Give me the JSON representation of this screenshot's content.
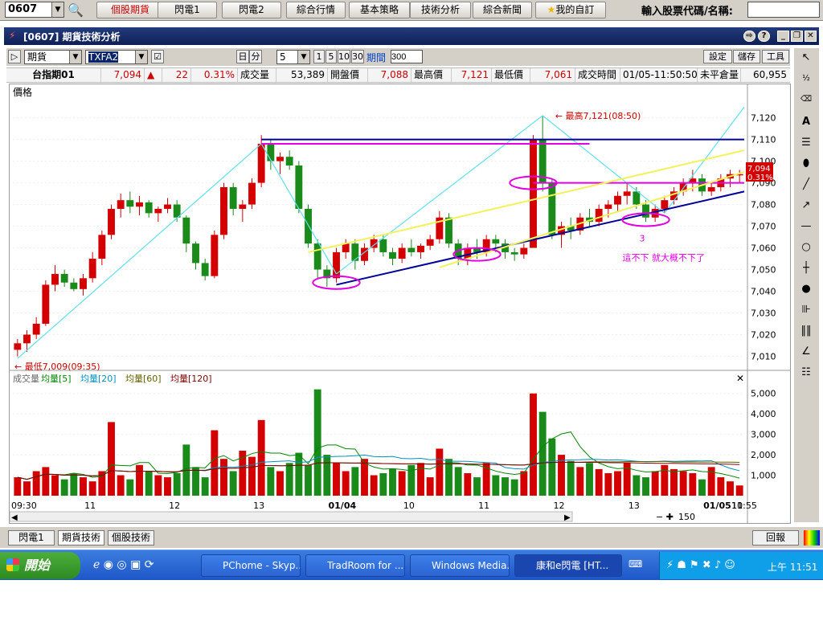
{
  "topbar": {
    "code": "0607",
    "tabs": [
      "個股期貨",
      "閃電1",
      "閃電2",
      "綜合行情",
      "基本策略",
      "技術分析",
      "綜合新聞"
    ],
    "favorite": "我的自訂",
    "input_label": "輸入股票代碼/名稱:",
    "input_value": ""
  },
  "window": {
    "title": "[0607] 期貨技術分析"
  },
  "toolbar": {
    "type": "期貨",
    "symbol": "TXFA2",
    "unit_day": "日",
    "unit_min": "分",
    "interval": "5",
    "quick": [
      "1",
      "5",
      "10",
      "30"
    ],
    "period_label": "期間",
    "period": "300",
    "buttons": [
      "設定",
      "儲存",
      "工具"
    ]
  },
  "quote": {
    "name": "台指期01",
    "price": "7,094",
    "arrow": "▲",
    "change": "22",
    "pct": "0.31%",
    "vol_label": "成交量",
    "vol": "53,389",
    "open_label": "開盤價",
    "open": "7,088",
    "high_label": "最高價",
    "high": "7,121",
    "low_label": "最低價",
    "low": "7,061",
    "time_label": "成交時間",
    "time": "01/05-11:50:50",
    "oi_label": "未平倉量",
    "oi": "60,955"
  },
  "chart_data": [
    {
      "type": "candlestick",
      "title": "價格",
      "ylim": [
        7005,
        7128
      ],
      "y_ticks": [
        7010,
        7020,
        7030,
        7040,
        7050,
        7060,
        7070,
        7080,
        7090,
        7100,
        7110,
        7120
      ],
      "annotations": {
        "high": "最高7,121(08:50)",
        "low": "最低7,009(09:35)",
        "note": "這不下 就大概不下了",
        "mark": "3",
        "last_price": "7,094",
        "last_pct": "0.31%"
      },
      "ohlc": [
        [
          7013,
          7018,
          7010,
          7016
        ],
        [
          7016,
          7022,
          7012,
          7020
        ],
        [
          7020,
          7028,
          7018,
          7025
        ],
        [
          7025,
          7045,
          7024,
          7043
        ],
        [
          7043,
          7052,
          7040,
          7048
        ],
        [
          7048,
          7050,
          7042,
          7044
        ],
        [
          7044,
          7046,
          7040,
          7041
        ],
        [
          7041,
          7048,
          7038,
          7046
        ],
        [
          7046,
          7058,
          7044,
          7055
        ],
        [
          7055,
          7068,
          7052,
          7066
        ],
        [
          7066,
          7080,
          7064,
          7078
        ],
        [
          7078,
          7085,
          7074,
          7082
        ],
        [
          7082,
          7086,
          7076,
          7079
        ],
        [
          7079,
          7084,
          7075,
          7081
        ],
        [
          7081,
          7082,
          7074,
          7076
        ],
        [
          7076,
          7079,
          7072,
          7078
        ],
        [
          7078,
          7083,
          7076,
          7080
        ],
        [
          7080,
          7082,
          7072,
          7074
        ],
        [
          7074,
          7075,
          7058,
          7062
        ],
        [
          7062,
          7063,
          7050,
          7053
        ],
        [
          7053,
          7055,
          7045,
          7047
        ],
        [
          7047,
          7068,
          7046,
          7066
        ],
        [
          7066,
          7090,
          7064,
          7088
        ],
        [
          7088,
          7090,
          7075,
          7078
        ],
        [
          7078,
          7082,
          7072,
          7080
        ],
        [
          7080,
          7092,
          7078,
          7090
        ],
        [
          7090,
          7112,
          7088,
          7108
        ],
        [
          7108,
          7110,
          7096,
          7100
        ],
        [
          7100,
          7104,
          7094,
          7102
        ],
        [
          7102,
          7105,
          7096,
          7098
        ],
        [
          7098,
          7100,
          7076,
          7078
        ],
        [
          7078,
          7080,
          7060,
          7062
        ],
        [
          7062,
          7064,
          7046,
          7050
        ],
        [
          7050,
          7052,
          7042,
          7046
        ],
        [
          7046,
          7060,
          7044,
          7058
        ],
        [
          7058,
          7064,
          7055,
          7062
        ],
        [
          7062,
          7064,
          7050,
          7054
        ],
        [
          7054,
          7062,
          7052,
          7060
        ],
        [
          7060,
          7066,
          7058,
          7064
        ],
        [
          7064,
          7066,
          7056,
          7058
        ],
        [
          7058,
          7060,
          7052,
          7055
        ],
        [
          7055,
          7062,
          7053,
          7060
        ],
        [
          7060,
          7064,
          7056,
          7058
        ],
        [
          7058,
          7062,
          7055,
          7061
        ],
        [
          7061,
          7066,
          7059,
          7064
        ],
        [
          7064,
          7077,
          7062,
          7074
        ],
        [
          7074,
          7076,
          7060,
          7062
        ],
        [
          7062,
          7064,
          7052,
          7055
        ],
        [
          7055,
          7062,
          7052,
          7060
        ],
        [
          7060,
          7064,
          7055,
          7058
        ],
        [
          7058,
          7066,
          7056,
          7064
        ],
        [
          7064,
          7066,
          7058,
          7062
        ],
        [
          7062,
          7064,
          7055,
          7058
        ],
        [
          7058,
          7060,
          7054,
          7057
        ],
        [
          7057,
          7062,
          7055,
          7060
        ],
        [
          7060,
          7112,
          7060,
          7110
        ],
        [
          7110,
          7121,
          7086,
          7090
        ],
        [
          7090,
          7092,
          7064,
          7066
        ],
        [
          7066,
          7072,
          7060,
          7070
        ],
        [
          7070,
          7074,
          7064,
          7068
        ],
        [
          7068,
          7076,
          7066,
          7074
        ],
        [
          7074,
          7078,
          7070,
          7072
        ],
        [
          7072,
          7080,
          7070,
          7078
        ],
        [
          7078,
          7082,
          7074,
          7080
        ],
        [
          7080,
          7086,
          7077,
          7084
        ],
        [
          7084,
          7090,
          7080,
          7086
        ],
        [
          7086,
          7088,
          7078,
          7080
        ],
        [
          7080,
          7082,
          7072,
          7074
        ],
        [
          7074,
          7080,
          7072,
          7078
        ],
        [
          7078,
          7084,
          7076,
          7082
        ],
        [
          7082,
          7088,
          7080,
          7086
        ],
        [
          7086,
          7092,
          7084,
          7090
        ],
        [
          7090,
          7096,
          7086,
          7092
        ],
        [
          7092,
          7094,
          7084,
          7086
        ],
        [
          7086,
          7090,
          7084,
          7088
        ],
        [
          7088,
          7094,
          7086,
          7092
        ],
        [
          7092,
          7096,
          7088,
          7094
        ],
        [
          7094,
          7096,
          7090,
          7094
        ]
      ]
    },
    {
      "type": "bar",
      "title": "成交量",
      "legend": [
        "成交量",
        "均量[5]",
        "均量[20]",
        "均量[60]",
        "均量[120]"
      ],
      "ylim": [
        0,
        5500
      ],
      "y_ticks": [
        1000,
        2000,
        3000,
        4000,
        5000
      ],
      "x_labels": [
        "09:30",
        "11",
        "12",
        "13",
        "01/04",
        "10",
        "11",
        "12",
        "13",
        "01/05",
        "10",
        "11",
        "11:55"
      ],
      "values": [
        900,
        700,
        1200,
        1400,
        1000,
        800,
        1100,
        900,
        700,
        1200,
        3600,
        1000,
        800,
        1500,
        1200,
        1000,
        900,
        1100,
        2500,
        1400,
        900,
        3200,
        1800,
        1200,
        2200,
        1900,
        3700,
        1400,
        1200,
        1600,
        2100,
        1500,
        5200,
        2000,
        1600,
        1200,
        1400,
        1800,
        1000,
        1100,
        1300,
        1200,
        1500,
        1600,
        900,
        2300,
        1800,
        1400,
        1100,
        900,
        1600,
        1000,
        900,
        800,
        1200,
        5000,
        4100,
        2800,
        2000,
        1700,
        1400,
        1600,
        1300,
        1100,
        1200,
        1600,
        1000,
        900,
        1200,
        1500,
        1300,
        1200,
        1100,
        800,
        1400,
        900,
        700,
        500
      ]
    }
  ],
  "chart_colors": {
    "up": "#d40000",
    "down": "#1a8a1a",
    "trend_blue": "#000099",
    "trend_yellow": "#f2f25a",
    "cyan": "#5fe0f0",
    "magenta": "#e000e0",
    "ma5": "#008800",
    "ma20": "#0090c0",
    "ma60": "#606000",
    "ma120": "#800000"
  },
  "bottom": {
    "tabs": [
      "閃電1",
      "期貨技術",
      "個股技術"
    ],
    "report": "回報",
    "scale": "150"
  },
  "taskbar": {
    "start": "開始",
    "tasks": [
      "PChome - Skyp...",
      "TradRoom for ...",
      "Windows Media...",
      "康和e閃電 [HT..."
    ],
    "clock": "上午 11:51"
  },
  "icons": {
    "search": "search-icon",
    "star": "star-icon"
  }
}
